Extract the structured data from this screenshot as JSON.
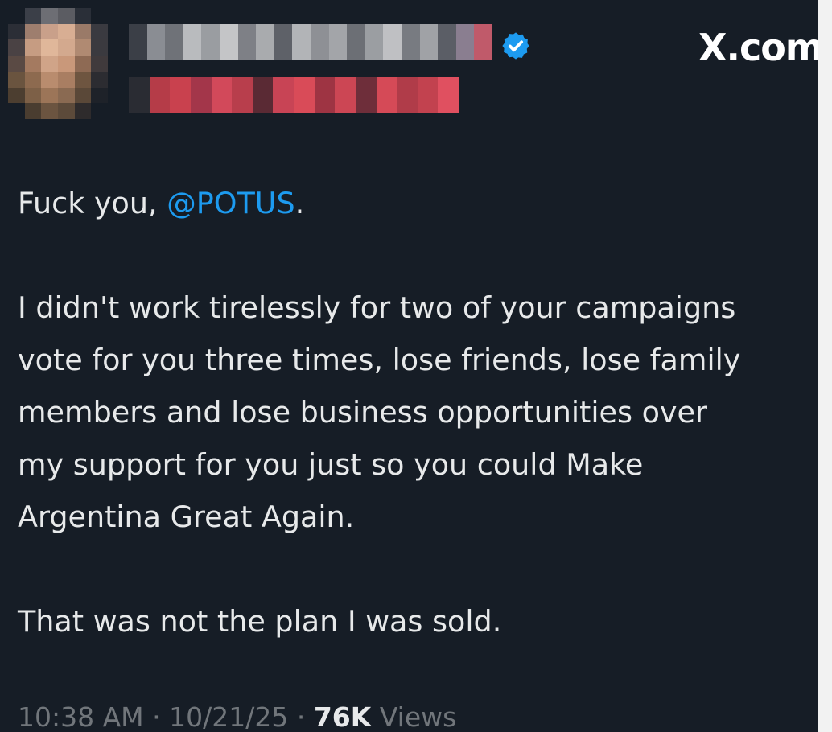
{
  "site": {
    "brand_label": "X.com"
  },
  "author": {
    "verified_icon": "verified-badge-icon",
    "badge_color": "#1d9bf0",
    "name_obscured": true,
    "handle_obscured": true,
    "avatar_obscured": true
  },
  "tweet": {
    "line1_prefix": "Fuck you, ",
    "mention": "@POTUS",
    "line1_suffix": ".",
    "paragraph2": [
      "I didn't work tirelessly for two of your campaigns",
      "vote for you three times, lose friends, lose family",
      "members and lose business opportunities over",
      "my support for you just so you could Make",
      "Argentina Great Again."
    ],
    "paragraph3": "That was not the plan I was sold."
  },
  "meta": {
    "time": "10:38 AM",
    "separator": " · ",
    "date": "10/21/25",
    "views_count": "76K",
    "views_label": " Views"
  },
  "colors": {
    "background": "#161d26",
    "text": "#e7e9ea",
    "link": "#1d9bf0",
    "muted": "#71767b"
  }
}
